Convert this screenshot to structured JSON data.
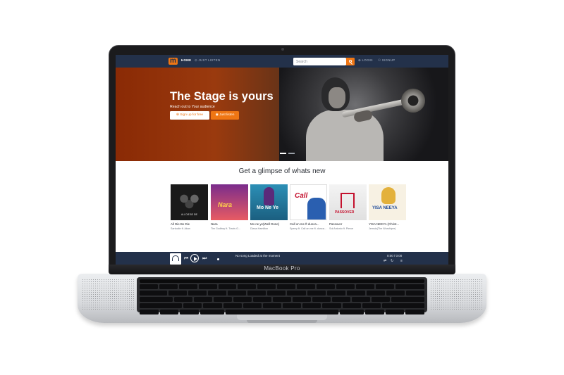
{
  "device": {
    "label": "MacBook Pro"
  },
  "nav": {
    "logo": "m",
    "home": "HOME",
    "just_listen": "⊙ JUST LISTEN",
    "search_placeholder": "Search",
    "login": "⊕ LOGIN",
    "signup": "⚇ SIGNUP"
  },
  "hero": {
    "title": "The Stage is yours",
    "subtitle": "Reach out to Your audience",
    "signup_button": "⊕ Sign up for free",
    "listen_button": "◉ Just listen"
  },
  "glimpse": {
    "title": "Get a glimpse of whats new",
    "items": [
      {
        "title": "All Die Be Die",
        "artist": "Sarkodie ft. Akan",
        "cover_text": "ALL DIE BE DIE"
      },
      {
        "title": "Nara",
        "artist": "Tim Godfrey ft. Travis G...",
        "cover_text": "Nara"
      },
      {
        "title": "Mo ne ye(Well Done)",
        "artist": "Diana Hamilton",
        "cover_text": "Mo Ne Ye"
      },
      {
        "title": "Call on me ft dunca...",
        "artist": "Sperry ft. Call on me ft. dunca...",
        "cover_text": "Call"
      },
      {
        "title": "Passover",
        "artist": "Sol Antonio ft. Pierce",
        "cover_text": "PASSOVER"
      },
      {
        "title": "YISA NEEYA (Christ...",
        "artist": "Jemsio(The Worshiper)",
        "cover_text": "YISA NEEYA"
      }
    ]
  },
  "player": {
    "status": "No song Loaded at the moment",
    "time": "0:00 / 0:00"
  },
  "colors": {
    "accent": "#ef7614",
    "nav_bg": "#23314a"
  },
  "icons": [
    "search-icon",
    "headphones-icon",
    "previous-icon",
    "play-icon",
    "next-icon",
    "shuffle-icon",
    "repeat-icon",
    "queue-icon"
  ]
}
